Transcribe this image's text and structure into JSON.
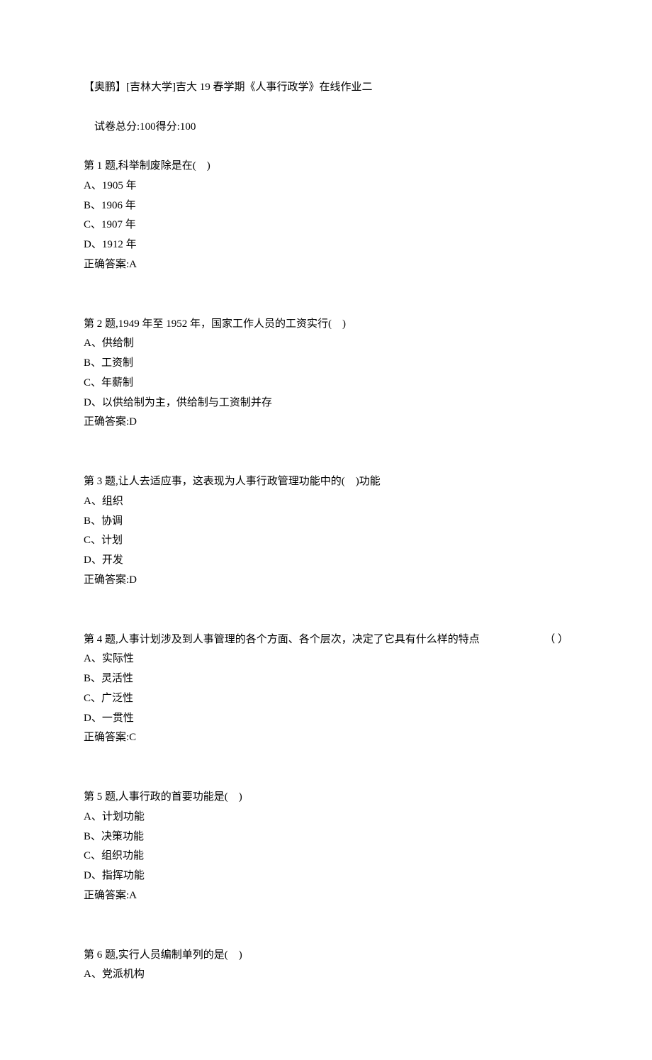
{
  "header": {
    "title": "【奥鹏】[吉林大学]吉大 19 春学期《人事行政学》在线作业二",
    "score_total_label": "试卷总分:100",
    "score_gain_label": "得分:100"
  },
  "questions": [
    {
      "stem": "第 1 题,科举制废除是在(    )",
      "options": [
        "A、1905 年",
        "B、1906 年",
        "C、1907 年",
        "D、1912 年"
      ],
      "answer": "正确答案:A"
    },
    {
      "stem": "第 2 题,1949 年至 1952 年，国家工作人员的工资实行(    )",
      "options": [
        "A、供给制",
        "B、工资制",
        "C、年薪制",
        "D、以供给制为主，供给制与工资制并存"
      ],
      "answer": "正确答案:D"
    },
    {
      "stem": "第 3 题,让人去适应事，这表现为人事行政管理功能中的(    )功能",
      "options": [
        "A、组织",
        "B、协调",
        "C、计划",
        "D、开发"
      ],
      "answer": "正确答案:D"
    },
    {
      "stem_left": "第 4 题,人事计划涉及到人事管理的各个方面、各个层次，决定了它具有什么样的特点",
      "stem_right": "（    ）",
      "options": [
        "A、实际性",
        "B、灵活性",
        "C、广泛性",
        "D、一贯性"
      ],
      "answer": "正确答案:C"
    },
    {
      "stem": "第 5 题,人事行政的首要功能是(    )",
      "options": [
        "A、计划功能",
        "B、决策功能",
        "C、组织功能",
        "D、指挥功能"
      ],
      "answer": "正确答案:A"
    },
    {
      "stem": "第 6 题,实行人员编制单列的是(    )",
      "options": [
        "A、党派机构"
      ]
    }
  ]
}
